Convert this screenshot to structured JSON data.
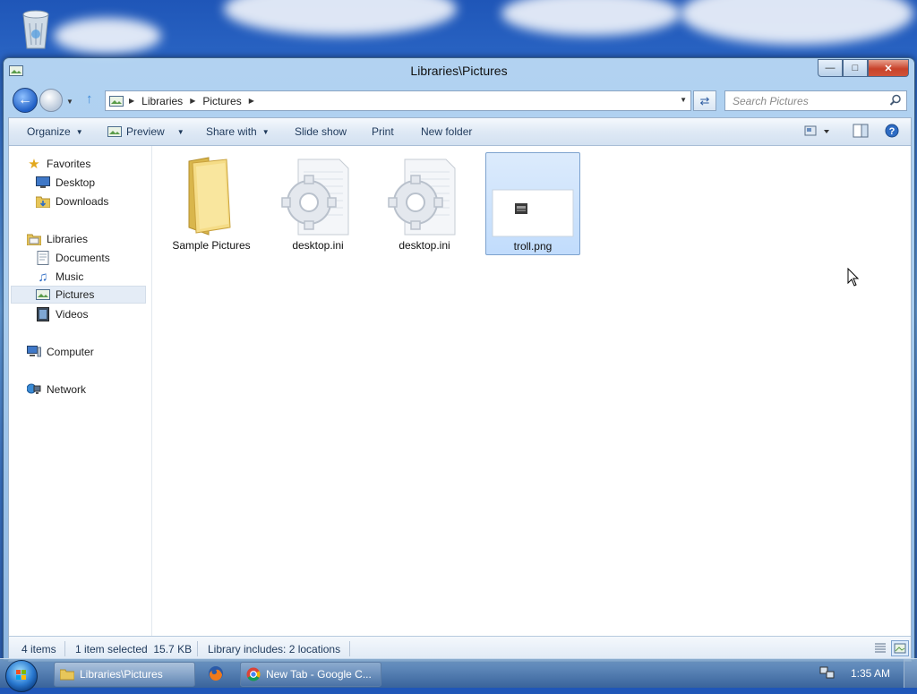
{
  "window": {
    "title": "Libraries\\Pictures",
    "caption_minimize": "—",
    "caption_maximize": "□",
    "caption_close": "✕"
  },
  "navigation": {
    "breadcrumb": [
      "Libraries",
      "Pictures"
    ],
    "search_placeholder": "Search Pictures"
  },
  "toolbar": {
    "organize": "Organize",
    "preview": "Preview",
    "share_with": "Share with",
    "slide_show": "Slide show",
    "print": "Print",
    "new_folder": "New folder"
  },
  "sidebar": {
    "favorites": {
      "label": "Favorites",
      "items": [
        "Desktop",
        "Downloads"
      ]
    },
    "libraries": {
      "label": "Libraries",
      "items": [
        "Documents",
        "Music",
        "Pictures",
        "Videos"
      ]
    },
    "computer": "Computer",
    "network": "Network",
    "selected": "Pictures"
  },
  "files": [
    {
      "name": "Sample Pictures",
      "type": "folder"
    },
    {
      "name": "desktop.ini",
      "type": "settings"
    },
    {
      "name": "desktop.ini",
      "type": "settings"
    },
    {
      "name": "troll.png",
      "type": "image",
      "selected": true
    }
  ],
  "status": {
    "item_count": "4 items",
    "selection": "1 item selected  15.7 KB",
    "library_info": "Library includes: 2 locations"
  },
  "taskbar": {
    "explorer_task": "Libraries\\Pictures",
    "chrome_task": "New Tab - Google C...",
    "clock": "1:35 AM"
  }
}
